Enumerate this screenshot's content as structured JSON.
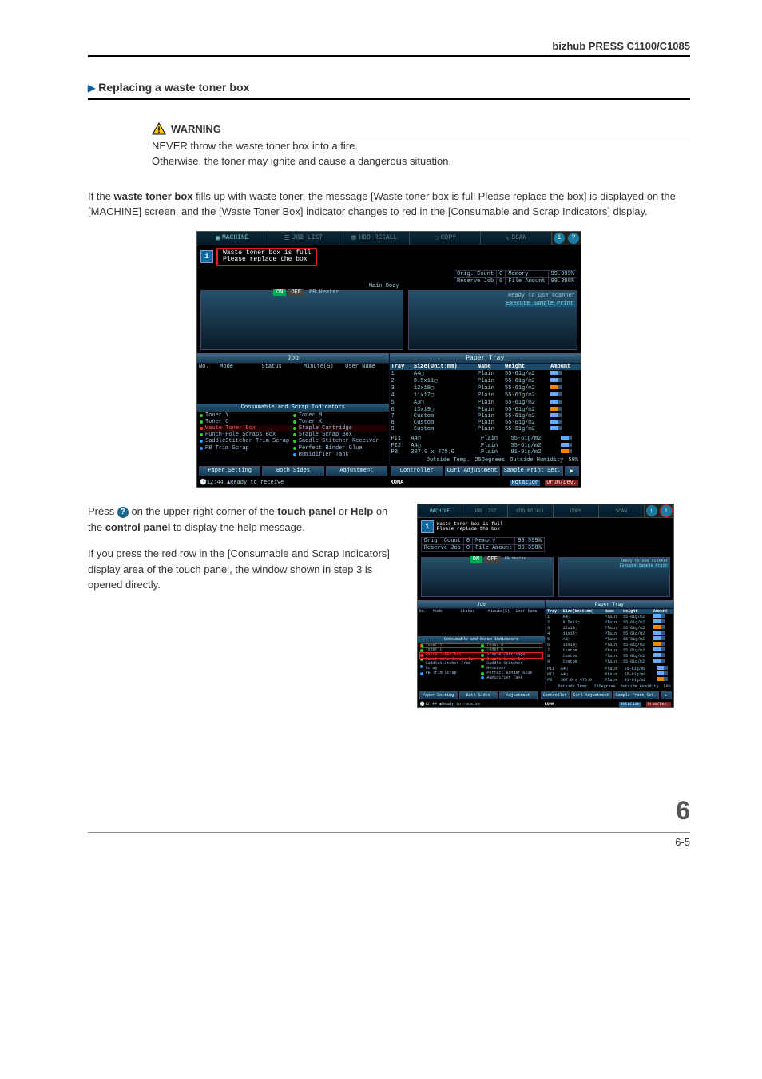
{
  "header": {
    "model": "bizhub PRESS C1100/C1085"
  },
  "section": {
    "title": "Replacing a waste toner box"
  },
  "warning": {
    "label": "WARNING",
    "line1": "NEVER throw the waste toner box into a fire.",
    "line2": "Otherwise, the toner may ignite and cause a dangerous situation."
  },
  "intro": {
    "prefix": "If the ",
    "bold1": "waste toner box",
    "rest": " fills up with waste toner, the message [Waste toner box is full Please replace the box] is displayed on the [MACHINE] screen, and the [Waste Toner Box] indicator changes to red in the [Consumable and Scrap Indicators] display."
  },
  "screenshot": {
    "tabs": {
      "machine": "MACHINE",
      "joblist": "JOB LIST",
      "hdd": "HDD RECALL",
      "copy": "COPY",
      "scan": "SCAN"
    },
    "help": {
      "i": "i",
      "q": "?"
    },
    "message": {
      "line1": "Waste toner box is full",
      "line2": "Please replace the box"
    },
    "mainbody": "Main Body",
    "pbheater": "PB Heater",
    "on": "ON",
    "off": "OFF",
    "stats": {
      "orig_label": "Orig. Count",
      "orig_val": "0",
      "reserve_label": "Reserve Job",
      "reserve_val": "0",
      "mem_label": "Memory",
      "mem_val": "99.999%",
      "file_label": "File Amount",
      "file_val": "99.398%"
    },
    "ready_scanner": "Ready to use scanner",
    "exec_sample": "Execute Sample Print",
    "job_panel": "Job",
    "paper_panel": "Paper Tray",
    "job_header": {
      "no": "No.",
      "mode": "Mode",
      "status": "Status",
      "minute": "Minute(S)",
      "user": "User Name"
    },
    "cons_title": "Consumable and Scrap Indicators",
    "cons": {
      "r1a": "Toner Y",
      "r1b": "Toner M",
      "r2a": "Toner C",
      "r2b": "Toner K",
      "r3a": "Waste Toner Box",
      "r3b": "Staple Cartridge",
      "r4a": "Punch-Hole Scraps Box",
      "r4b": "Staple Scrap Box",
      "r5a": "SaddleStitcher Trim Scrap",
      "r5b": "Saddle Stitcher Receiver",
      "r6a": "PB Trim Scrap",
      "r6b": "Perfect Binder Glue",
      "r7b": "Humidifier Tank"
    },
    "paper_header": {
      "tray": "Tray",
      "size": "Size(Unit:mm)",
      "name": "Name",
      "weight": "Weight",
      "amount": "Amount"
    },
    "paper_rows": [
      {
        "tray": "1",
        "size": "A4▢",
        "name": "Plain",
        "weight": "55-61g/m2"
      },
      {
        "tray": "2",
        "size": "8.5x11▢",
        "name": "Plain",
        "weight": "55-61g/m2"
      },
      {
        "tray": "3",
        "size": "12x18▢",
        "name": "Plain",
        "weight": "55-61g/m2"
      },
      {
        "tray": "4",
        "size": "11x17▢",
        "name": "Plain",
        "weight": "55-61g/m2"
      },
      {
        "tray": "5",
        "size": "A3▢",
        "name": "Plain",
        "weight": "55-61g/m2"
      },
      {
        "tray": "6",
        "size": "13x19▢",
        "name": "Plain",
        "weight": "55-61g/m2"
      },
      {
        "tray": "7",
        "size": "Custom",
        "name": "Plain",
        "weight": "55-61g/m2"
      },
      {
        "tray": "8",
        "size": "Custom",
        "name": "Plain",
        "weight": "55-61g/m2"
      },
      {
        "tray": "9",
        "size": "Custom",
        "name": "Plain",
        "weight": "55-61g/m2"
      }
    ],
    "paper_pi": [
      {
        "tray": "PI1",
        "size": "A4▢",
        "name": "Plain",
        "weight": "55-61g/m2"
      },
      {
        "tray": "PI2",
        "size": "A4▢",
        "name": "Plain",
        "weight": "55-61g/m2"
      },
      {
        "tray": "PB",
        "size": "307.0 x 470.0",
        "name": "Plain",
        "weight": "81-91g/m2"
      }
    ],
    "env": {
      "temp_l": "Outside Temp.",
      "temp_v": "25Degrees",
      "hum_l": "Outside Humidity",
      "hum_v": "50%"
    },
    "bottom_left": {
      "paper": "Paper Setting",
      "both": "Both Sides",
      "adj": "Adjustment"
    },
    "bottom_right": {
      "ctrl": "Controller",
      "curl": "Curl Adjustment",
      "sample": "Sample Print Set.",
      "arrow": "▶"
    },
    "status": {
      "time": "12:44",
      "ready": "Ready to receive",
      "rot": "Rotation",
      "drum": "Drum/Dev."
    },
    "logo": "KOMA"
  },
  "step_text": {
    "p1_a": "Press ",
    "p1_b": " on the upper-right corner of the ",
    "p1_bold1": "touch panel",
    "p1_c": " or ",
    "p1_bold2": "Help",
    "p1_d": " on the ",
    "p1_bold3": "control panel",
    "p1_e": " to display the help message.",
    "p2": "If you press the red row in the [Consumable and Scrap Indicators] display area of the touch panel, the window shown in step 3 is opened directly."
  },
  "chart_data": {
    "type": "table",
    "title": "Paper Tray",
    "columns": [
      "Tray",
      "Size(Unit:mm)",
      "Name",
      "Weight"
    ],
    "rows": [
      [
        "1",
        "A4",
        "Plain",
        "55-61g/m2"
      ],
      [
        "2",
        "8.5x11",
        "Plain",
        "55-61g/m2"
      ],
      [
        "3",
        "12x18",
        "Plain",
        "55-61g/m2"
      ],
      [
        "4",
        "11x17",
        "Plain",
        "55-61g/m2"
      ],
      [
        "5",
        "A3",
        "Plain",
        "55-61g/m2"
      ],
      [
        "6",
        "13x19",
        "Plain",
        "55-61g/m2"
      ],
      [
        "7",
        "Custom",
        "Plain",
        "55-61g/m2"
      ],
      [
        "8",
        "Custom",
        "Plain",
        "55-61g/m2"
      ],
      [
        "9",
        "Custom",
        "Plain",
        "55-61g/m2"
      ],
      [
        "PI1",
        "A4",
        "Plain",
        "55-61g/m2"
      ],
      [
        "PI2",
        "A4",
        "Plain",
        "55-61g/m2"
      ],
      [
        "PB",
        "307.0 x 470.0",
        "Plain",
        "81-91g/m2"
      ]
    ]
  },
  "footer": {
    "big": "6",
    "small": "6-5"
  }
}
